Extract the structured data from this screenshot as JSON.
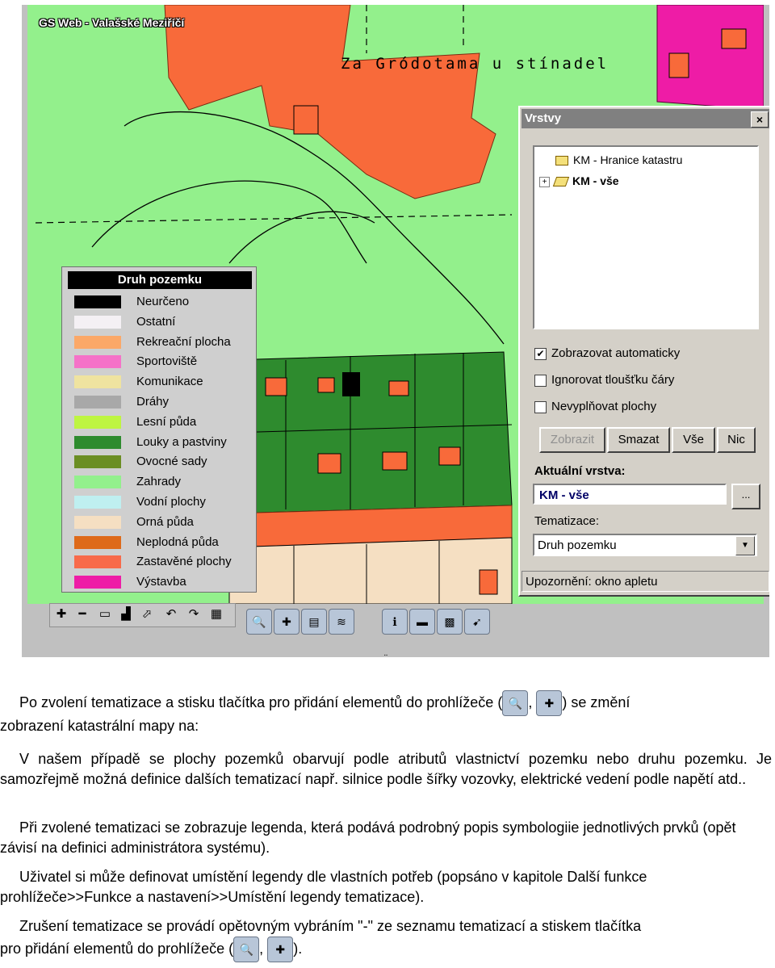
{
  "map": {
    "title": "GS Web - Valašské Meziříčí",
    "street_label": "Za Gródotama u stínadel",
    "colors": {
      "background": "#93f08c",
      "built": "#f86a3a",
      "forest": "#2e8b2e",
      "arable": "#f5dfc2",
      "construction": "#ee1ca6"
    }
  },
  "legend": {
    "title": "Druh pozemku",
    "items": [
      {
        "label": "Neurčeno",
        "color": "#000000"
      },
      {
        "label": "Ostatní",
        "color": "#f4f0f4"
      },
      {
        "label": "Rekreační plocha",
        "color": "#fba868"
      },
      {
        "label": "Sportoviště",
        "color": "#f572c8"
      },
      {
        "label": "Komunikace",
        "color": "#efe3a0"
      },
      {
        "label": "Dráhy",
        "color": "#a8a8a8"
      },
      {
        "label": "Lesní půda",
        "color": "#bef541"
      },
      {
        "label": "Louky a pastviny",
        "color": "#2e8b2e"
      },
      {
        "label": "Ovocné sady",
        "color": "#6b8e23"
      },
      {
        "label": "Zahrady",
        "color": "#93f08c"
      },
      {
        "label": "Vodní plochy",
        "color": "#bfeff0"
      },
      {
        "label": "Orná půda",
        "color": "#f5dfc2"
      },
      {
        "label": "Neplodná půda",
        "color": "#de6a1a"
      },
      {
        "label": "Zastavěné plochy",
        "color": "#f86a4a"
      },
      {
        "label": "Výstavba",
        "color": "#ee1ca6"
      }
    ]
  },
  "map_toolbar": {
    "icons": [
      "zoom-in-icon",
      "zoom-out-icon",
      "full-extent-icon",
      "pan-icon",
      "select-icon",
      "undo-icon",
      "redo-icon",
      "print-icon"
    ]
  },
  "app_toolbar": {
    "buttons": [
      "add-elements-icon",
      "add-elements-alt-icon",
      "document-icon",
      "layers-icon",
      "info-icon",
      "measure-icon",
      "select-area-icon",
      "pointer-icon"
    ]
  },
  "layers_window": {
    "title": "Vrstvy",
    "close_label": "×",
    "tree": [
      {
        "label": "KM - Hranice katastru",
        "expand": ""
      },
      {
        "label": "KM - vše",
        "expand": "+"
      }
    ],
    "checkboxes": [
      {
        "label": "Zobrazovat automaticky",
        "checked": true
      },
      {
        "label": "Ignorovat tloušťku čáry",
        "checked": false
      },
      {
        "label": "Nevyplňovat plochy",
        "checked": false
      }
    ],
    "buttons": {
      "show": "Zobrazit",
      "delete": "Smazat",
      "all": "Vše",
      "none": "Nic"
    },
    "current_layer_label": "Aktuální vrstva:",
    "current_layer_value": "KM - vše",
    "browse_label": "...",
    "thematic_label": "Tematizace:",
    "thematic_value": "Druh pozemku",
    "status": "Upozornění: okno apletu"
  },
  "document": {
    "marker": "¨",
    "p1_a": "Po zvolení tematizace a stisku tlačítka pro přidání elementů do prohlížeče (",
    "p1_sep": ",",
    "p1_b": ") se změní",
    "p1_c": "zobrazení katastrální mapy na:",
    "p2": "V našem případě se plochy pozemků obarvují podle atributů vlastnictví pozemku nebo druhu pozemku. Je samozřejmě možná definice dalších tematizací např. silnice podle šířky vozovky, elektrické vedení podle napětí atd..",
    "p3": "Při zvolené tematizaci se zobrazuje legenda, která podává podrobný popis symbologiie jednotlivých prvků (opět závisí na definici administrátora systému).",
    "p4": "Uživatel si může definovat umístění legendy dle vlastních potřeb (popsáno v kapitole Další funkce prohlížeče>>Funkce a nastavení>>Umístění legendy tematizace).",
    "p5_a": "Zrušení tematizace se provádí opětovným vybráním \"-\"  ze seznamu tematizací a stiskem tlačítka",
    "p5_b": "pro přidání elementů do prohlížeče (",
    "p5_sep": ",",
    "p5_c": ")."
  }
}
